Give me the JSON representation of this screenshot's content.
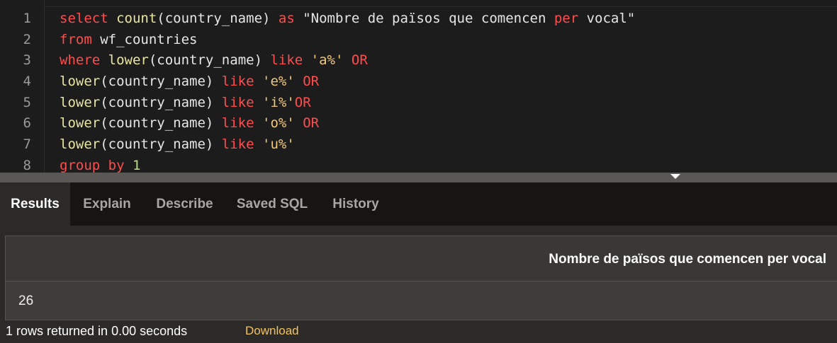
{
  "editor": {
    "lines": [
      {
        "num": "1",
        "tokens": [
          [
            "select",
            "kw"
          ],
          [
            " ",
            ""
          ],
          [
            "count",
            "fn"
          ],
          [
            "(country_name) ",
            ""
          ],
          [
            "as",
            "kw"
          ],
          [
            " \"Nombre de països que comencen ",
            "dq"
          ],
          [
            "per",
            "kw"
          ],
          [
            " vocal\"",
            "dq"
          ]
        ]
      },
      {
        "num": "2",
        "tokens": [
          [
            "from",
            "kw"
          ],
          [
            " wf_countries",
            ""
          ]
        ]
      },
      {
        "num": "3",
        "tokens": [
          [
            "where",
            "kw"
          ],
          [
            " ",
            ""
          ],
          [
            "lower",
            "fn"
          ],
          [
            "(country_name) ",
            ""
          ],
          [
            "like",
            "kw"
          ],
          [
            " ",
            ""
          ],
          [
            "'a%'",
            "str"
          ],
          [
            " ",
            ""
          ],
          [
            "OR",
            "kw"
          ]
        ]
      },
      {
        "num": "4",
        "tokens": [
          [
            "lower",
            "fn"
          ],
          [
            "(country_name) ",
            ""
          ],
          [
            "like",
            "kw"
          ],
          [
            " ",
            ""
          ],
          [
            "'e%'",
            "str"
          ],
          [
            " ",
            ""
          ],
          [
            "OR",
            "kw"
          ]
        ]
      },
      {
        "num": "5",
        "tokens": [
          [
            "lower",
            "fn"
          ],
          [
            "(country_name) ",
            ""
          ],
          [
            "like",
            "kw"
          ],
          [
            " ",
            ""
          ],
          [
            "'i%'",
            "str"
          ],
          [
            "OR",
            "kw"
          ]
        ]
      },
      {
        "num": "6",
        "tokens": [
          [
            "lower",
            "fn"
          ],
          [
            "(country_name) ",
            ""
          ],
          [
            "like",
            "kw"
          ],
          [
            " ",
            ""
          ],
          [
            "'o%'",
            "str"
          ],
          [
            " ",
            ""
          ],
          [
            "OR",
            "kw"
          ]
        ]
      },
      {
        "num": "7",
        "tokens": [
          [
            "lower",
            "fn"
          ],
          [
            "(country_name) ",
            ""
          ],
          [
            "like",
            "kw"
          ],
          [
            " ",
            ""
          ],
          [
            "'u%'",
            "str"
          ]
        ]
      },
      {
        "num": "8",
        "tokens": [
          [
            "group",
            "kw"
          ],
          [
            " ",
            ""
          ],
          [
            "by",
            "kw"
          ],
          [
            " ",
            ""
          ],
          [
            "1",
            "num"
          ]
        ]
      }
    ]
  },
  "tabs": {
    "results": "Results",
    "explain": "Explain",
    "describe": "Describe",
    "saved_sql": "Saved SQL",
    "history": "History"
  },
  "results": {
    "column_header": "Nombre de països que comencen per vocal",
    "rows": [
      "26"
    ],
    "status": "1 rows returned in 0.00 seconds",
    "download_label": "Download"
  },
  "colors": {
    "keyword": "#ff4d4d",
    "function": "#e8e6a0",
    "string": "#f2c97a",
    "download_link": "#f4c35a"
  }
}
